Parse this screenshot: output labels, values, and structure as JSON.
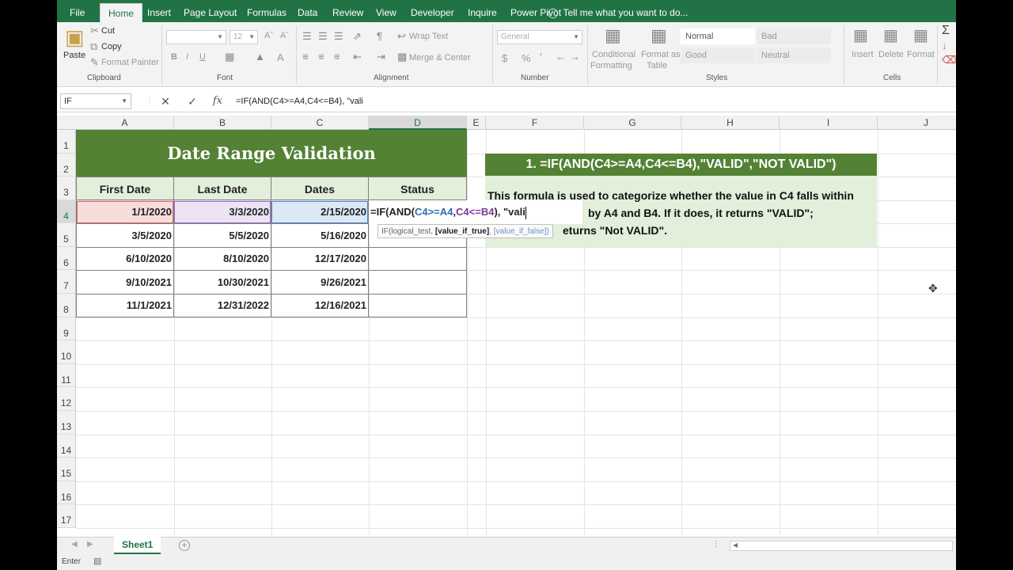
{
  "tabs": [
    "File",
    "Home",
    "Insert",
    "Page Layout",
    "Formulas",
    "Data",
    "Review",
    "View",
    "Developer",
    "Inquire",
    "Power Pivot"
  ],
  "tell_me": "Tell me what you want to do...",
  "ribbon": {
    "clipboard": {
      "paste": "Paste",
      "cut": "Cut",
      "copy": "Copy",
      "format_painter": "Format Painter",
      "label": "Clipboard"
    },
    "font": {
      "size": "12",
      "bold": "B",
      "italic": "I",
      "underline": "U",
      "label": "Font"
    },
    "alignment": {
      "wrap": "Wrap Text",
      "merge": "Merge & Center",
      "label": "Alignment"
    },
    "number": {
      "format": "General",
      "currency": "$",
      "percent": "%",
      "label": "Number"
    },
    "styles": {
      "conditional_1": "Conditional",
      "conditional_2": "Formatting",
      "format_as_1": "Format as",
      "format_as_2": "Table",
      "normal": "Normal",
      "bad": "Bad",
      "good": "Good",
      "neutral": "Neutral",
      "label": "Styles"
    },
    "cells": {
      "insert": "Insert",
      "delete": "Delete",
      "format": "Format",
      "label": "Cells"
    }
  },
  "formula_bar": {
    "name_box": "IF",
    "cancel": "✕",
    "enter": "✓",
    "fx": "fx",
    "formula": "=IF(AND(C4>=A4,C4<=B4), \"vali"
  },
  "columns": [
    "A",
    "B",
    "C",
    "D",
    "E",
    "F",
    "G",
    "H",
    "I",
    "J"
  ],
  "rows": [
    "1",
    "2",
    "3",
    "4",
    "5",
    "6",
    "7",
    "8",
    "9",
    "10",
    "11",
    "12",
    "13",
    "14",
    "15",
    "16",
    "17"
  ],
  "sheet": {
    "title": "Date Range Validation",
    "headers": [
      "First Date",
      "Last Date",
      "Dates",
      "Status"
    ],
    "data": [
      [
        "1/1/2020",
        "3/3/2020",
        "2/15/2020"
      ],
      [
        "3/5/2020",
        "5/5/2020",
        "5/16/2020"
      ],
      [
        "6/10/2020",
        "8/10/2020",
        "12/17/2020"
      ],
      [
        "9/10/2021",
        "10/30/2021",
        "9/26/2021"
      ],
      [
        "11/1/2021",
        "12/31/2022",
        "12/16/2021"
      ]
    ],
    "editing": {
      "p1": "=IF(AND(",
      "r1": "C4>=A4",
      "comma": ",",
      "r2": "C4<=B4",
      "p2": "), \"vali"
    },
    "tooltip": {
      "fn": "IF(logical_test, ",
      "cur": "[value_if_true]",
      "rest": ", [value_if_false])"
    }
  },
  "note": {
    "header": "1.  =IF(AND(C4>=A4,C4<=B4),\"VALID\",\"NOT VALID\")",
    "line1": "This formula is used to categorize whether the value in C4 falls within",
    "line2": "by A4 and B4. If it does, it returns \"VALID\";",
    "line3": "eturns \"Not VALID\"."
  },
  "sheet_tab": "Sheet1",
  "status": "Enter",
  "colors": {
    "ribbon_green": "#217346",
    "title_fill": "#548235",
    "header_fill": "#e2efda"
  }
}
